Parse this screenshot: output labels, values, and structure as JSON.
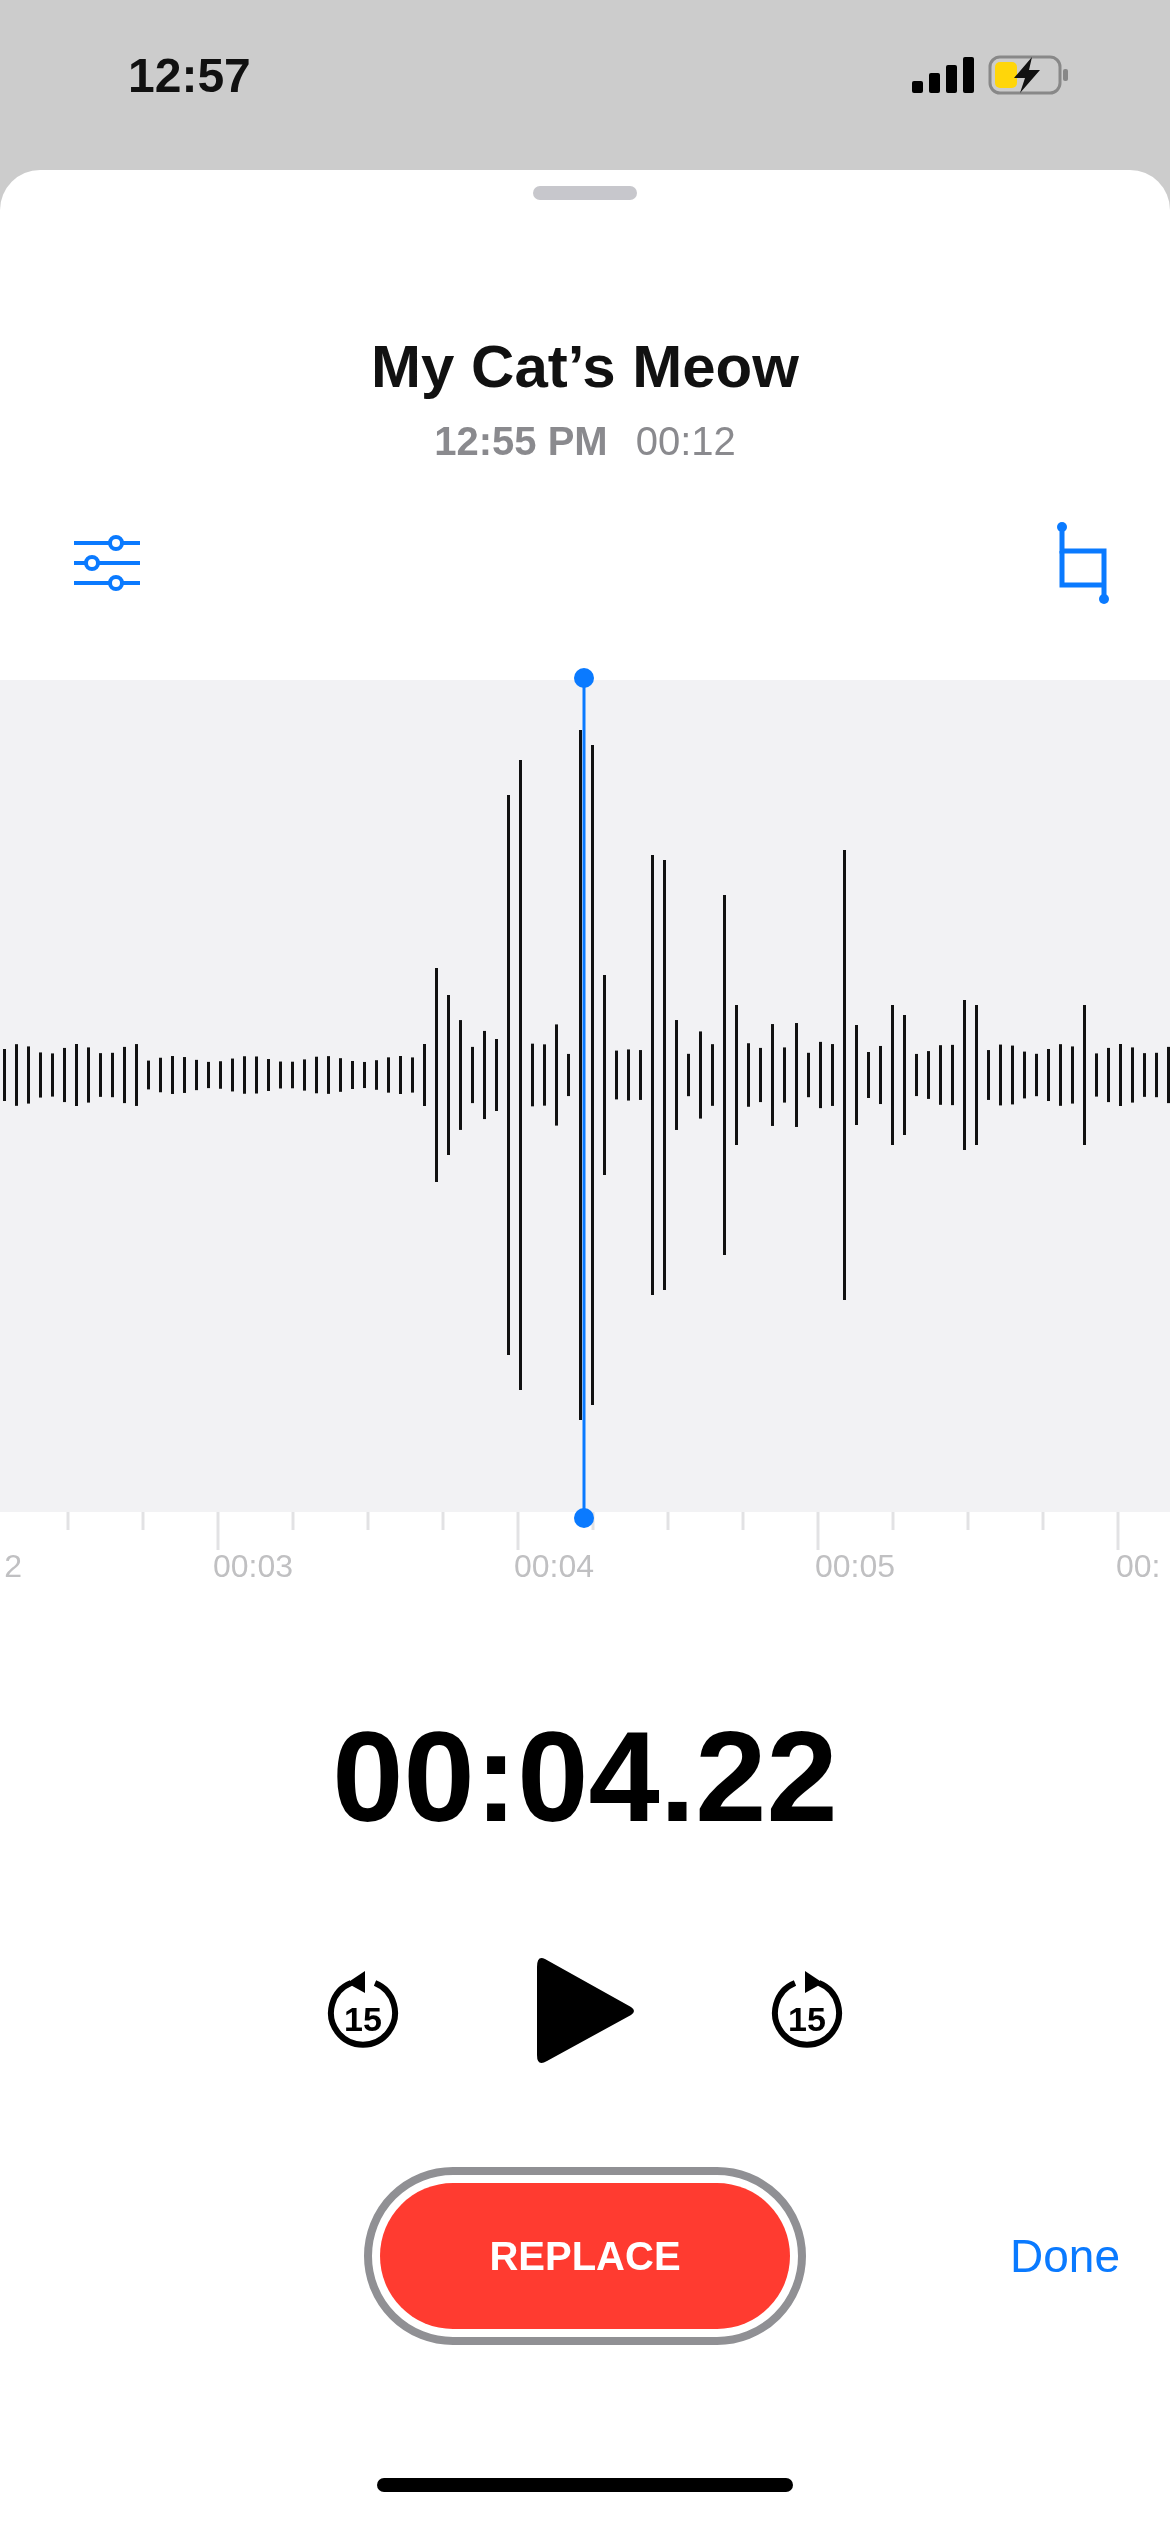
{
  "status_bar": {
    "time": "12:57"
  },
  "recording": {
    "title": "My Cat’s Meow",
    "date": "12:55 PM",
    "duration": "00:12"
  },
  "timeline": {
    "labels": [
      "2",
      "00:03",
      "00:04",
      "00:05",
      "00:"
    ]
  },
  "current_time": "00:04.22",
  "controls": {
    "skip_back": "15",
    "skip_forward": "15"
  },
  "buttons": {
    "replace": "REPLACE",
    "done": "Done"
  }
}
